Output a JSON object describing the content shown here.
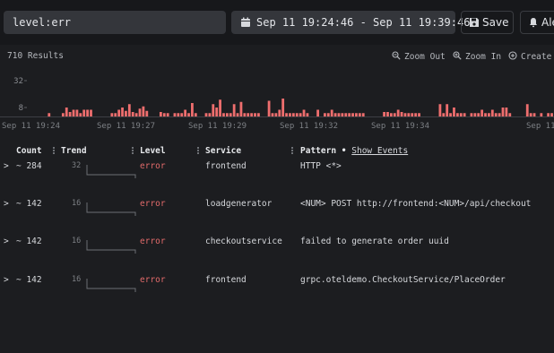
{
  "search": {
    "value": "level:err"
  },
  "daterange": {
    "value": "Sep 11 19:24:46 - Sep 11 19:39:46"
  },
  "toolbar": {
    "save_label": "Save",
    "alert_label": "Ale"
  },
  "results": {
    "label": "710 Results"
  },
  "chart_controls": {
    "zoom_out": "Zoom Out",
    "zoom_in": "Zoom In",
    "create": "Create"
  },
  "colors": {
    "bar": "#ee6e6e",
    "error": "#e06a6a",
    "background": "#1c1d20"
  },
  "chart_data": {
    "type": "bar",
    "yticks": [
      32,
      8
    ],
    "ylim": [
      0,
      40
    ],
    "xticks": [
      "Sep 11 19:24",
      "Sep 11 19:27",
      "Sep 11 19:29",
      "Sep 11 19:32",
      "Sep 11 19:34",
      "Sep 11"
    ],
    "values": [
      0,
      0,
      0,
      0,
      0,
      0,
      3,
      0,
      0,
      0,
      3,
      8,
      4,
      6,
      6,
      3,
      6,
      6,
      6,
      0,
      0,
      0,
      0,
      0,
      3,
      3,
      6,
      8,
      5,
      11,
      4,
      3,
      7,
      9,
      5,
      0,
      0,
      0,
      4,
      3,
      3,
      0,
      3,
      3,
      3,
      6,
      3,
      12,
      3,
      0,
      0,
      3,
      3,
      11,
      8,
      15,
      3,
      3,
      3,
      11,
      3,
      13,
      3,
      3,
      3,
      3,
      3,
      0,
      0,
      14,
      3,
      3,
      6,
      16,
      3,
      3,
      3,
      3,
      3,
      6,
      3,
      0,
      0,
      6,
      0,
      3,
      3,
      6,
      3,
      3,
      3,
      3,
      3,
      3,
      3,
      3,
      3,
      0,
      0,
      0,
      0,
      0,
      4,
      4,
      3,
      3,
      6,
      4,
      3,
      3,
      3,
      3,
      3,
      0,
      0,
      0,
      0,
      0,
      11,
      3,
      11,
      3,
      8,
      3,
      3,
      3,
      0,
      3,
      3,
      3,
      6,
      3,
      3,
      6,
      3,
      3,
      8,
      8,
      3,
      0,
      0,
      0,
      0,
      11,
      3,
      3,
      0,
      3,
      0,
      3,
      3
    ]
  },
  "table": {
    "headers": {
      "count": "Count",
      "trend": "Trend",
      "level": "Level",
      "service": "Service",
      "pattern": "Pattern",
      "bullet": "•",
      "show_events": "Show Events"
    },
    "rows": [
      {
        "caret": ">",
        "count": "~ 284",
        "trend_max": "32",
        "level": "error",
        "service": "frontend",
        "pattern": "HTTP <*>"
      },
      {
        "caret": ">",
        "count": "~ 142",
        "trend_max": "16",
        "level": "error",
        "service": "loadgenerator",
        "pattern": "<NUM> POST http://frontend:<NUM>/api/checkout"
      },
      {
        "caret": ">",
        "count": "~ 142",
        "trend_max": "16",
        "level": "error",
        "service": "checkoutservice",
        "pattern": "failed to generate order uuid"
      },
      {
        "caret": ">",
        "count": "~ 142",
        "trend_max": "16",
        "level": "error",
        "service": "frontend",
        "pattern": "grpc.oteldemo.CheckoutService/PlaceOrder"
      }
    ]
  }
}
